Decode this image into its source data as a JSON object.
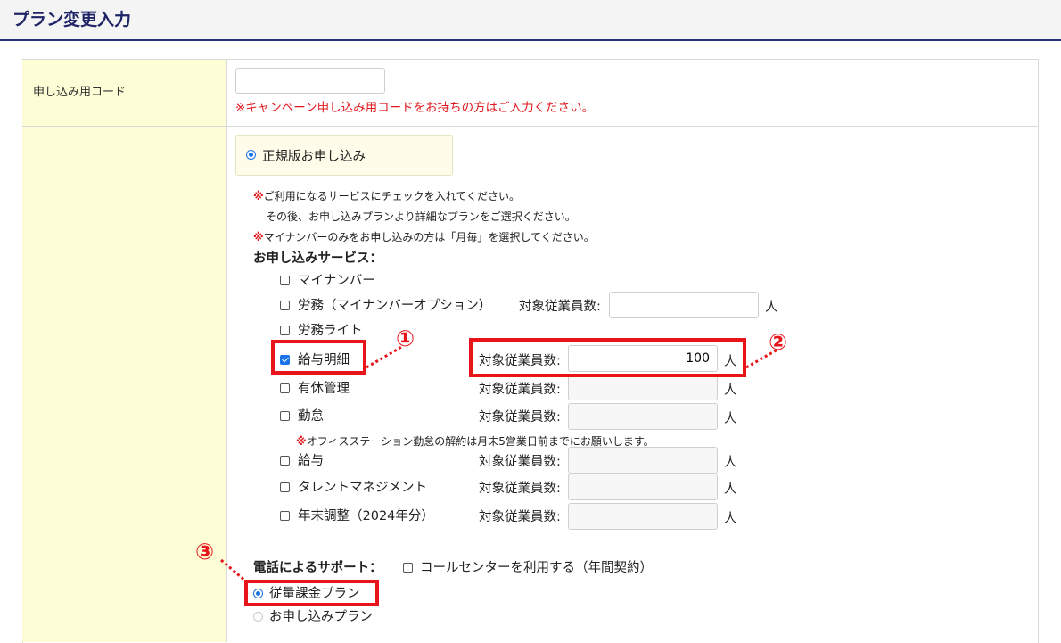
{
  "page": {
    "title": "プラン変更入力"
  },
  "campaign": {
    "label": "申し込み用コード",
    "code_value": "",
    "note": "※キャンペーン申し込み用コードをお持ちの方はご入力ください。"
  },
  "plan_type": {
    "selected_label": "正規版お申し込み"
  },
  "instructions": {
    "mark": "※",
    "line1": "ご利用になるサービスにチェックを入れてください。",
    "line2": "その後、お申し込みプランより詳細なプランをご選択ください。",
    "line3": "マイナンバーのみをお申し込みの方は「月毎」を選択してください。"
  },
  "services": {
    "heading": "お申し込みサービス：",
    "count_label": "対象従業員数:",
    "unit": "人",
    "items": [
      {
        "label": "マイナンバー",
        "checked": false
      },
      {
        "label": "労務（マイナンバーオプション）",
        "checked": false,
        "count": ""
      },
      {
        "label": "労務ライト",
        "checked": false
      },
      {
        "label": "給与明細",
        "checked": true,
        "count": "100"
      },
      {
        "label": "有休管理",
        "checked": false,
        "count": ""
      },
      {
        "label": "勤怠",
        "checked": false,
        "count": ""
      },
      {
        "label": "給与",
        "checked": false,
        "count": ""
      },
      {
        "label": "タレントマネジメント",
        "checked": false,
        "count": ""
      },
      {
        "label": "年末調整（2024年分）",
        "checked": false,
        "count": ""
      }
    ],
    "kintai_note_mark": "※",
    "kintai_note": "オフィスステーション勤怠の解約は月末5営業日前までにお願いします。"
  },
  "phone_support": {
    "label": "電話によるサポート：",
    "option": "コールセンターを利用する（年間契約）",
    "checked": false
  },
  "pricing_plan": {
    "options": [
      {
        "label": "従量課金プラン",
        "selected": true
      },
      {
        "label": "お申し込みプラン",
        "selected": false
      }
    ]
  },
  "annotations": {
    "color": "#e8141a",
    "markers": [
      "①",
      "②",
      "③"
    ]
  }
}
